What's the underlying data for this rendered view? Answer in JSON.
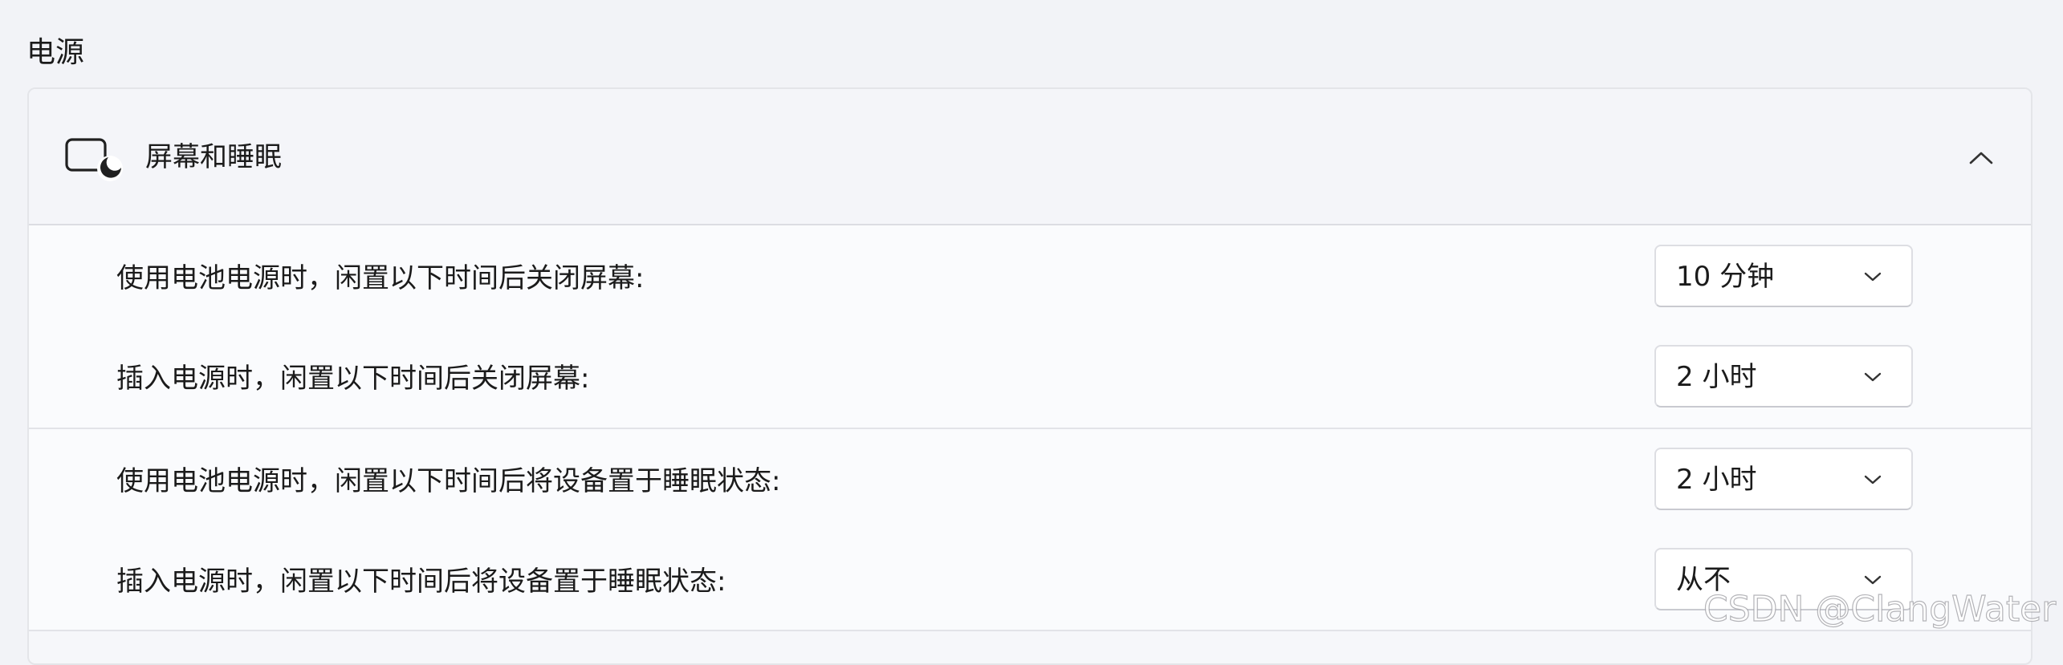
{
  "section": {
    "title": "电源"
  },
  "screen_sleep": {
    "icon": "screen-sleep-icon",
    "label": "屏幕和睡眠",
    "expanded": true,
    "collapse_icon": "chevron-up-icon"
  },
  "settings": [
    {
      "label": "使用电池电源时，闲置以下时间后关闭屏幕:",
      "value": "10 分钟"
    },
    {
      "label": "插入电源时，闲置以下时间后关闭屏幕:",
      "value": "2 小时"
    },
    {
      "label": "使用电池电源时，闲置以下时间后将设备置于睡眠状态:",
      "value": "2 小时"
    },
    {
      "label": "插入电源时，闲置以下时间后将设备置于睡眠状态:",
      "value": "从不"
    }
  ],
  "watermark": "CSDN @ClangWater"
}
